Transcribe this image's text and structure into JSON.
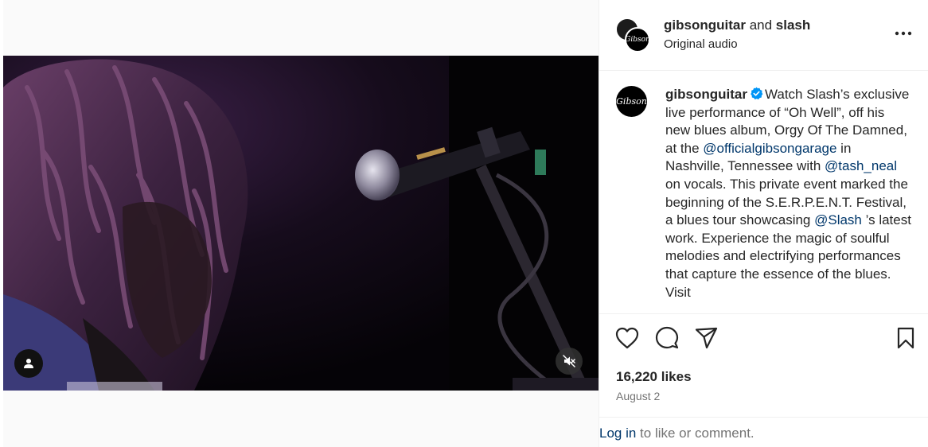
{
  "header": {
    "user_primary": "gibsonguitar",
    "and": "and",
    "user_secondary": "slash",
    "audio": "Original audio",
    "more_icon": "more-horizontal-icon",
    "avatar_text": "Gibson"
  },
  "caption": {
    "username": "gibsonguitar",
    "avatar_text": "Gibson",
    "text_1": "Watch Slash’s exclusive live performance of “Oh Well”, off his new blues album, Orgy Of The Damned, at the ",
    "mention_1": "@officialgibsongarage",
    "text_2": " in Nashville, Tennessee with ",
    "mention_2": "@tash_neal",
    "text_3": " on vocals. This private event marked the beginning of the S.E.R.P.E.N.T. Festival, a blues tour showcasing ",
    "mention_3": "@Slash",
    "text_4": " ’s latest work. Experience the magic of soulful melodies and electrifying performances that capture the essence of the blues. Visit"
  },
  "media": {
    "tag_icon": "user-tag-icon",
    "mute_icon": "muted-speaker-icon"
  },
  "actions": {
    "like_icon": "heart-icon",
    "comment_icon": "comment-icon",
    "share_icon": "share-icon",
    "save_icon": "bookmark-icon"
  },
  "stats": {
    "likes": "16,220 likes",
    "date": "August 2"
  },
  "footer": {
    "login_link": "Log in",
    "login_rest": " to like or comment."
  },
  "colors": {
    "link": "#00376b",
    "verified": "#0095f6",
    "muted_text": "#737373"
  }
}
